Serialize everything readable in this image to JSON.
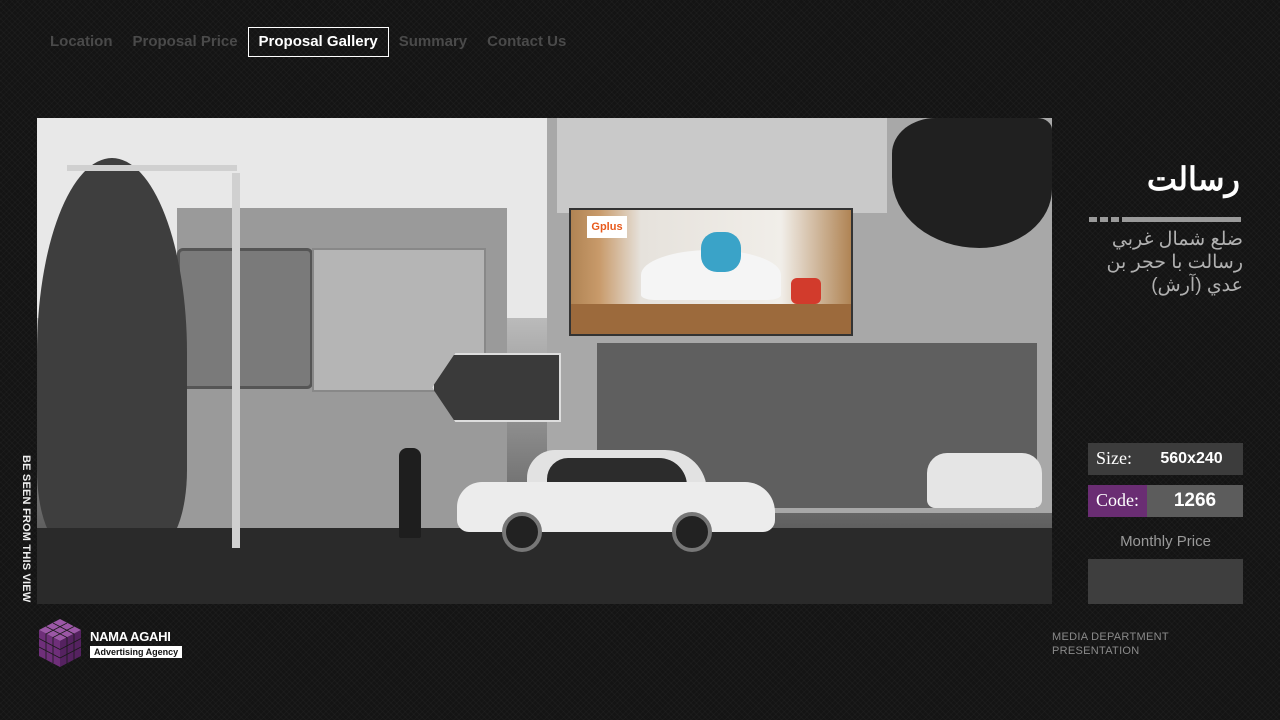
{
  "nav": {
    "items": [
      {
        "label": "Location",
        "active": false
      },
      {
        "label": "Proposal Price",
        "active": false
      },
      {
        "label": "Proposal Gallery",
        "active": true
      },
      {
        "label": "Summary",
        "active": false
      },
      {
        "label": "Contact Us",
        "active": false
      }
    ]
  },
  "photo": {
    "caption": "BE SEEN FROM THIS VIEW",
    "billboard_brand": "Gplus"
  },
  "location": {
    "title": "رسالت",
    "description": "ضلع شمال غربي رسالت با حجر بن عدي (آرش)"
  },
  "specs": {
    "size_label": "Size:",
    "size_value": "560x240",
    "code_label": "Code:",
    "code_value": "1266",
    "monthly_price_label": "Monthly Price",
    "monthly_price_value": ""
  },
  "brand": {
    "name": "NAMA AGAHI",
    "tagline": "Advertising Agency"
  },
  "footer": {
    "line1": "MEDIA DEPARTMENT",
    "line2": "PRESENTATION"
  },
  "colors": {
    "background": "#141414",
    "code_accent": "#6a2d73",
    "logo": "#7b3a86"
  }
}
